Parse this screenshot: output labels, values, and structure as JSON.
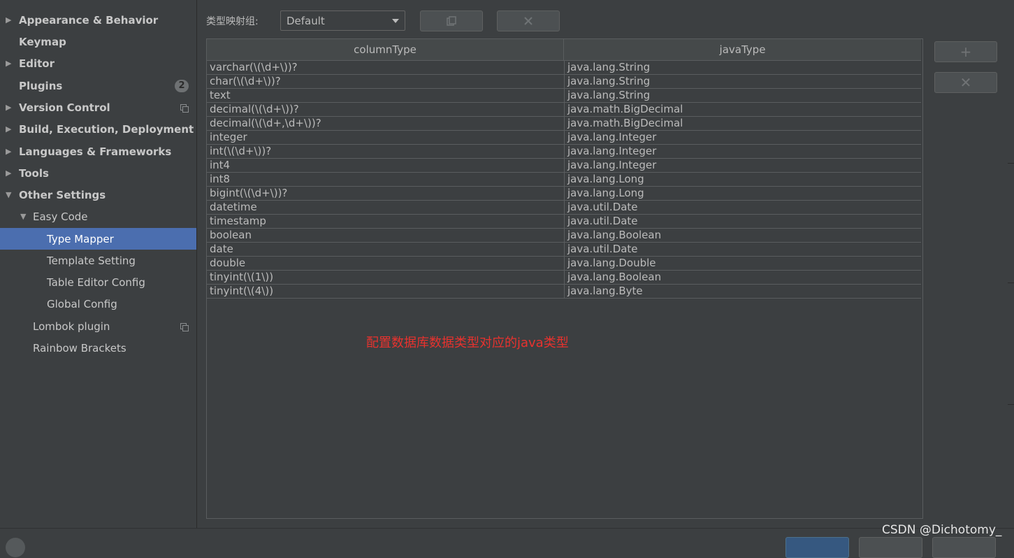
{
  "sidebar": {
    "items": [
      {
        "label": "Appearance & Behavior",
        "expandable": true,
        "expanded": false
      },
      {
        "label": "Keymap"
      },
      {
        "label": "Editor",
        "expandable": true,
        "expanded": false
      },
      {
        "label": "Plugins",
        "badge": "2"
      },
      {
        "label": "Version Control",
        "expandable": true,
        "expanded": false
      },
      {
        "label": "Build, Execution, Deployment",
        "expandable": true,
        "expanded": false
      },
      {
        "label": "Languages & Frameworks",
        "expandable": true,
        "expanded": false
      },
      {
        "label": "Tools",
        "expandable": true,
        "expanded": false
      },
      {
        "label": "Other Settings",
        "expandable": true,
        "expanded": true
      },
      {
        "label": "Easy Code",
        "expandable": true,
        "expanded": true
      },
      {
        "label": "Type Mapper",
        "selected": true
      },
      {
        "label": "Template Setting"
      },
      {
        "label": "Table Editor Config"
      },
      {
        "label": "Global Config"
      },
      {
        "label": "Lombok plugin"
      },
      {
        "label": "Rainbow Brackets"
      }
    ]
  },
  "toolbar": {
    "group_label": "类型映射组:",
    "group_value": "Default",
    "copy_icon": "copy-icon",
    "delete_icon": "close-icon"
  },
  "table": {
    "headers": [
      "columnType",
      "javaType"
    ],
    "rows": [
      [
        "varchar(\\(\\d+\\))?",
        "java.lang.String"
      ],
      [
        "char(\\(\\d+\\))?",
        "java.lang.String"
      ],
      [
        "text",
        "java.lang.String"
      ],
      [
        "decimal(\\(\\d+\\))?",
        "java.math.BigDecimal"
      ],
      [
        "decimal(\\(\\d+,\\d+\\))?",
        "java.math.BigDecimal"
      ],
      [
        "integer",
        "java.lang.Integer"
      ],
      [
        "int(\\(\\d+\\))?",
        "java.lang.Integer"
      ],
      [
        "int4",
        "java.lang.Integer"
      ],
      [
        "int8",
        "java.lang.Long"
      ],
      [
        "bigint(\\(\\d+\\))?",
        "java.lang.Long"
      ],
      [
        "datetime",
        "java.util.Date"
      ],
      [
        "timestamp",
        "java.util.Date"
      ],
      [
        "boolean",
        "java.lang.Boolean"
      ],
      [
        "date",
        "java.util.Date"
      ],
      [
        "double",
        "java.lang.Double"
      ],
      [
        "tinyint(\\(1\\))",
        "java.lang.Boolean"
      ],
      [
        "tinyint(\\(4\\))",
        "java.lang.Byte"
      ]
    ]
  },
  "side_buttons": {
    "add": "+",
    "remove": "✕"
  },
  "annotation": "配置数据库数据类型对应的java类型",
  "watermark": "CSDN @Dichotomy_",
  "colors": {
    "background": "#3c3f41",
    "selection": "#4b6eaf",
    "annotation": "#e8322e",
    "text": "#bbbbbb"
  }
}
